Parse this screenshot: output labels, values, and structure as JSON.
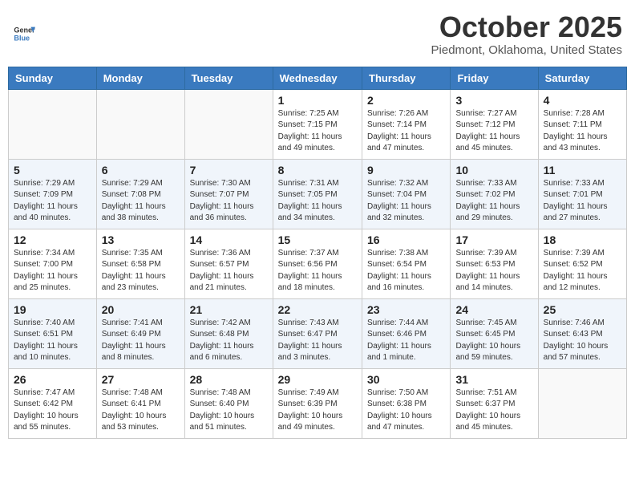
{
  "header": {
    "logo_general": "General",
    "logo_blue": "Blue",
    "month": "October 2025",
    "location": "Piedmont, Oklahoma, United States"
  },
  "days_of_week": [
    "Sunday",
    "Monday",
    "Tuesday",
    "Wednesday",
    "Thursday",
    "Friday",
    "Saturday"
  ],
  "weeks": [
    [
      {
        "day": "",
        "info": ""
      },
      {
        "day": "",
        "info": ""
      },
      {
        "day": "",
        "info": ""
      },
      {
        "day": "1",
        "info": "Sunrise: 7:25 AM\nSunset: 7:15 PM\nDaylight: 11 hours\nand 49 minutes."
      },
      {
        "day": "2",
        "info": "Sunrise: 7:26 AM\nSunset: 7:14 PM\nDaylight: 11 hours\nand 47 minutes."
      },
      {
        "day": "3",
        "info": "Sunrise: 7:27 AM\nSunset: 7:12 PM\nDaylight: 11 hours\nand 45 minutes."
      },
      {
        "day": "4",
        "info": "Sunrise: 7:28 AM\nSunset: 7:11 PM\nDaylight: 11 hours\nand 43 minutes."
      }
    ],
    [
      {
        "day": "5",
        "info": "Sunrise: 7:29 AM\nSunset: 7:09 PM\nDaylight: 11 hours\nand 40 minutes."
      },
      {
        "day": "6",
        "info": "Sunrise: 7:29 AM\nSunset: 7:08 PM\nDaylight: 11 hours\nand 38 minutes."
      },
      {
        "day": "7",
        "info": "Sunrise: 7:30 AM\nSunset: 7:07 PM\nDaylight: 11 hours\nand 36 minutes."
      },
      {
        "day": "8",
        "info": "Sunrise: 7:31 AM\nSunset: 7:05 PM\nDaylight: 11 hours\nand 34 minutes."
      },
      {
        "day": "9",
        "info": "Sunrise: 7:32 AM\nSunset: 7:04 PM\nDaylight: 11 hours\nand 32 minutes."
      },
      {
        "day": "10",
        "info": "Sunrise: 7:33 AM\nSunset: 7:02 PM\nDaylight: 11 hours\nand 29 minutes."
      },
      {
        "day": "11",
        "info": "Sunrise: 7:33 AM\nSunset: 7:01 PM\nDaylight: 11 hours\nand 27 minutes."
      }
    ],
    [
      {
        "day": "12",
        "info": "Sunrise: 7:34 AM\nSunset: 7:00 PM\nDaylight: 11 hours\nand 25 minutes."
      },
      {
        "day": "13",
        "info": "Sunrise: 7:35 AM\nSunset: 6:58 PM\nDaylight: 11 hours\nand 23 minutes."
      },
      {
        "day": "14",
        "info": "Sunrise: 7:36 AM\nSunset: 6:57 PM\nDaylight: 11 hours\nand 21 minutes."
      },
      {
        "day": "15",
        "info": "Sunrise: 7:37 AM\nSunset: 6:56 PM\nDaylight: 11 hours\nand 18 minutes."
      },
      {
        "day": "16",
        "info": "Sunrise: 7:38 AM\nSunset: 6:54 PM\nDaylight: 11 hours\nand 16 minutes."
      },
      {
        "day": "17",
        "info": "Sunrise: 7:39 AM\nSunset: 6:53 PM\nDaylight: 11 hours\nand 14 minutes."
      },
      {
        "day": "18",
        "info": "Sunrise: 7:39 AM\nSunset: 6:52 PM\nDaylight: 11 hours\nand 12 minutes."
      }
    ],
    [
      {
        "day": "19",
        "info": "Sunrise: 7:40 AM\nSunset: 6:51 PM\nDaylight: 11 hours\nand 10 minutes."
      },
      {
        "day": "20",
        "info": "Sunrise: 7:41 AM\nSunset: 6:49 PM\nDaylight: 11 hours\nand 8 minutes."
      },
      {
        "day": "21",
        "info": "Sunrise: 7:42 AM\nSunset: 6:48 PM\nDaylight: 11 hours\nand 6 minutes."
      },
      {
        "day": "22",
        "info": "Sunrise: 7:43 AM\nSunset: 6:47 PM\nDaylight: 11 hours\nand 3 minutes."
      },
      {
        "day": "23",
        "info": "Sunrise: 7:44 AM\nSunset: 6:46 PM\nDaylight: 11 hours\nand 1 minute."
      },
      {
        "day": "24",
        "info": "Sunrise: 7:45 AM\nSunset: 6:45 PM\nDaylight: 10 hours\nand 59 minutes."
      },
      {
        "day": "25",
        "info": "Sunrise: 7:46 AM\nSunset: 6:43 PM\nDaylight: 10 hours\nand 57 minutes."
      }
    ],
    [
      {
        "day": "26",
        "info": "Sunrise: 7:47 AM\nSunset: 6:42 PM\nDaylight: 10 hours\nand 55 minutes."
      },
      {
        "day": "27",
        "info": "Sunrise: 7:48 AM\nSunset: 6:41 PM\nDaylight: 10 hours\nand 53 minutes."
      },
      {
        "day": "28",
        "info": "Sunrise: 7:48 AM\nSunset: 6:40 PM\nDaylight: 10 hours\nand 51 minutes."
      },
      {
        "day": "29",
        "info": "Sunrise: 7:49 AM\nSunset: 6:39 PM\nDaylight: 10 hours\nand 49 minutes."
      },
      {
        "day": "30",
        "info": "Sunrise: 7:50 AM\nSunset: 6:38 PM\nDaylight: 10 hours\nand 47 minutes."
      },
      {
        "day": "31",
        "info": "Sunrise: 7:51 AM\nSunset: 6:37 PM\nDaylight: 10 hours\nand 45 minutes."
      },
      {
        "day": "",
        "info": ""
      }
    ]
  ]
}
